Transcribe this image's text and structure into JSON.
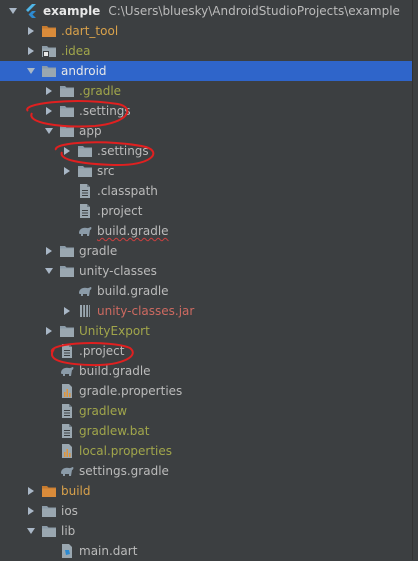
{
  "tree": [
    {
      "label": "example",
      "path": "C:\\Users\\bluesky\\AndroidStudioProjects\\example",
      "depth": 0,
      "arrow": "down",
      "icon": "flutter-icon",
      "color": "#e8e8e8",
      "bold": true
    },
    {
      "label": ".dart_tool",
      "depth": 1,
      "arrow": "right",
      "icon": "folder-icon-orange",
      "color": "#d8a14b"
    },
    {
      "label": ".idea",
      "depth": 1,
      "arrow": "right",
      "icon": "folder-idea-icon",
      "color": "#a1a64b"
    },
    {
      "label": "android",
      "depth": 1,
      "arrow": "down",
      "icon": "folder-icon",
      "color": "#e8e8e8",
      "selected": true
    },
    {
      "label": ".gradle",
      "depth": 2,
      "arrow": "right",
      "icon": "folder-icon",
      "color": "#a1a64b"
    },
    {
      "label": ".settings",
      "depth": 2,
      "arrow": "right",
      "icon": "folder-icon",
      "color": "#bbbbbb"
    },
    {
      "label": "app",
      "depth": 2,
      "arrow": "down",
      "icon": "folder-icon",
      "color": "#bbbbbb"
    },
    {
      "label": ".settings",
      "depth": 3,
      "arrow": "right",
      "icon": "folder-icon",
      "color": "#bbbbbb"
    },
    {
      "label": "src",
      "depth": 3,
      "arrow": "right",
      "icon": "folder-icon",
      "color": "#bbbbbb"
    },
    {
      "label": ".classpath",
      "depth": 3,
      "arrow": "none",
      "icon": "file-icon",
      "color": "#bbbbbb"
    },
    {
      "label": ".project",
      "depth": 3,
      "arrow": "none",
      "icon": "file-icon",
      "color": "#bbbbbb"
    },
    {
      "label": "build.gradle",
      "depth": 3,
      "arrow": "none",
      "icon": "gradle-icon",
      "color": "#bbbbbb",
      "squiggle": true
    },
    {
      "label": "gradle",
      "depth": 2,
      "arrow": "right",
      "icon": "folder-icon",
      "color": "#bbbbbb"
    },
    {
      "label": "unity-classes",
      "depth": 2,
      "arrow": "down",
      "icon": "folder-icon",
      "color": "#bbbbbb"
    },
    {
      "label": "build.gradle",
      "depth": 3,
      "arrow": "none",
      "icon": "gradle-icon",
      "color": "#bbbbbb"
    },
    {
      "label": "unity-classes.jar",
      "depth": 3,
      "arrow": "right",
      "icon": "jar-icon",
      "color": "#cd6a61"
    },
    {
      "label": "UnityExport",
      "depth": 2,
      "arrow": "right",
      "icon": "folder-icon",
      "color": "#a1a64b"
    },
    {
      "label": ".project",
      "depth": 2,
      "arrow": "none",
      "icon": "file-icon",
      "color": "#bbbbbb"
    },
    {
      "label": "build.gradle",
      "depth": 2,
      "arrow": "none",
      "icon": "gradle-icon",
      "color": "#bbbbbb"
    },
    {
      "label": "gradle.properties",
      "depth": 2,
      "arrow": "none",
      "icon": "properties-icon",
      "color": "#bbbbbb"
    },
    {
      "label": "gradlew",
      "depth": 2,
      "arrow": "none",
      "icon": "file-icon",
      "color": "#a1a64b"
    },
    {
      "label": "gradlew.bat",
      "depth": 2,
      "arrow": "none",
      "icon": "file-icon",
      "color": "#a1a64b"
    },
    {
      "label": "local.properties",
      "depth": 2,
      "arrow": "none",
      "icon": "properties-icon",
      "color": "#a1a64b"
    },
    {
      "label": "settings.gradle",
      "depth": 2,
      "arrow": "none",
      "icon": "gradle-icon",
      "color": "#bbbbbb"
    },
    {
      "label": "build",
      "depth": 1,
      "arrow": "right",
      "icon": "folder-icon-orange",
      "color": "#d8a14b"
    },
    {
      "label": "ios",
      "depth": 1,
      "arrow": "right",
      "icon": "folder-icon",
      "color": "#bbbbbb"
    },
    {
      "label": "lib",
      "depth": 1,
      "arrow": "down",
      "icon": "folder-icon",
      "color": "#bbbbbb"
    },
    {
      "label": "main.dart",
      "depth": 2,
      "arrow": "none",
      "icon": "dart-file-icon",
      "color": "#bbbbbb"
    }
  ],
  "colors": {
    "background": "#3c3f41",
    "selection": "#2f65ca",
    "annotation": "#e02020"
  }
}
